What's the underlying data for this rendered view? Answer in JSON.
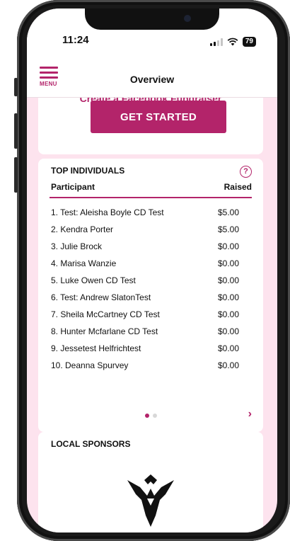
{
  "status_bar": {
    "time": "11:24",
    "battery": "79"
  },
  "header": {
    "menu_label": "MENU",
    "title": "Overview"
  },
  "fundraiser": {
    "cta_text": "Create a Facebook Fundraiser",
    "button_label": "GET STARTED"
  },
  "top_individuals": {
    "title": "TOP INDIVIDUALS",
    "help_symbol": "?",
    "columns": {
      "participant": "Participant",
      "raised": "Raised"
    },
    "rows": [
      {
        "name": "1.  Test: Aleisha Boyle CD Test",
        "raised": "$5.00"
      },
      {
        "name": "2.  Kendra Porter",
        "raised": "$5.00"
      },
      {
        "name": "3.  Julie Brock",
        "raised": "$0.00"
      },
      {
        "name": "4.  Marisa Wanzie",
        "raised": "$0.00"
      },
      {
        "name": "5.  Luke Owen CD Test",
        "raised": "$0.00"
      },
      {
        "name": "6.  Test: Andrew SlatonTest",
        "raised": "$0.00"
      },
      {
        "name": "7.  Sheila McCartney CD Test",
        "raised": "$0.00"
      },
      {
        "name": "8.  Hunter Mcfarlane CD Test",
        "raised": "$0.00"
      },
      {
        "name": "9.  Jessetest Helfrichtest",
        "raised": "$0.00"
      },
      {
        "name": "10.  Deanna Spurvey",
        "raised": "$0.00"
      }
    ],
    "next_symbol": "›"
  },
  "sponsors": {
    "title": "LOCAL SPONSORS"
  },
  "colors": {
    "accent": "#b3246a",
    "background": "#fde3ee"
  },
  "icons": {
    "menu": "hamburger-icon",
    "help": "question-circle-icon",
    "next": "chevron-right-icon",
    "wifi": "wifi-icon",
    "signal": "signal-icon",
    "logo": "sponsor-logo-icon"
  }
}
